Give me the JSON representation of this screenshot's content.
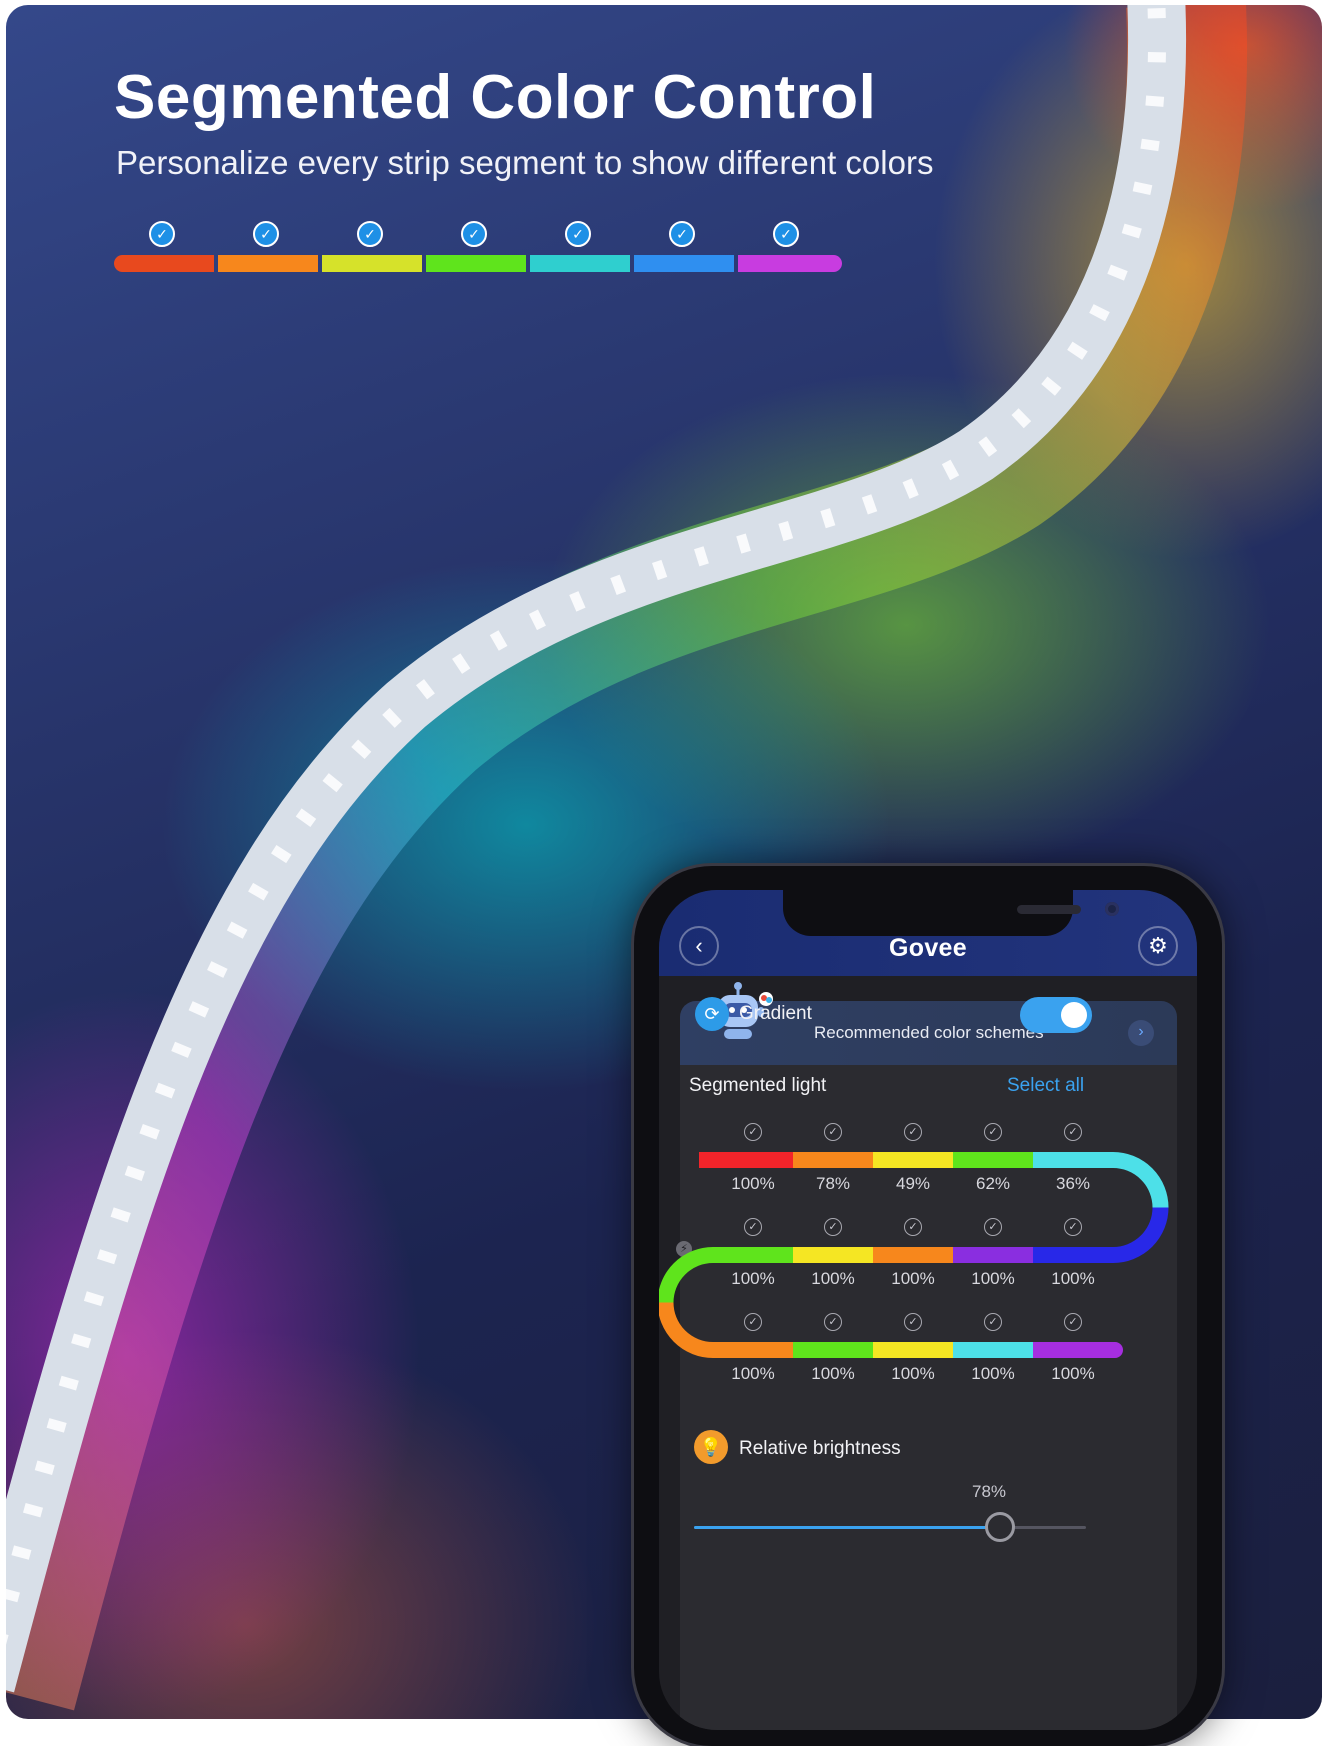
{
  "hero": {
    "title": "Segmented Color Control",
    "subtitle": "Personalize every strip segment to show different colors",
    "segment_colors": [
      "#e8491e",
      "#f7871c",
      "#d6e22a",
      "#5fe41c",
      "#2fcfcf",
      "#2f8ff0",
      "#c83ce0"
    ],
    "segment_checked": [
      true,
      true,
      true,
      true,
      true,
      true,
      true
    ]
  },
  "app": {
    "brand": "Govee",
    "recommended_label": "Recommended color schemes",
    "gradient_label": "Gradient",
    "gradient_on": true,
    "segmented_light_label": "Segmented light",
    "select_all_label": "Select all",
    "segments": {
      "row1": {
        "colors": [
          "#f2242a",
          "#f7871c",
          "#f5e623",
          "#5fe41c",
          "#4de0e8"
        ],
        "percents": [
          "100%",
          "78%",
          "49%",
          "62%",
          "36%"
        ]
      },
      "row2": {
        "colors": [
          "#5fe41c",
          "#f5e623",
          "#f7871c",
          "#8a2ee0",
          "#2828e8"
        ],
        "percents": [
          "100%",
          "100%",
          "100%",
          "100%",
          "100%"
        ]
      },
      "row3": {
        "colors": [
          "#f7871c",
          "#5fe41c",
          "#f5e623",
          "#4de0e8",
          "#a62ee0"
        ],
        "percents": [
          "100%",
          "100%",
          "100%",
          "100%",
          "100%"
        ]
      }
    },
    "relative_brightness_label": "Relative brightness",
    "brightness_value": "78%",
    "brightness_fraction": 0.78,
    "accent_color": "#3aa2ef"
  }
}
